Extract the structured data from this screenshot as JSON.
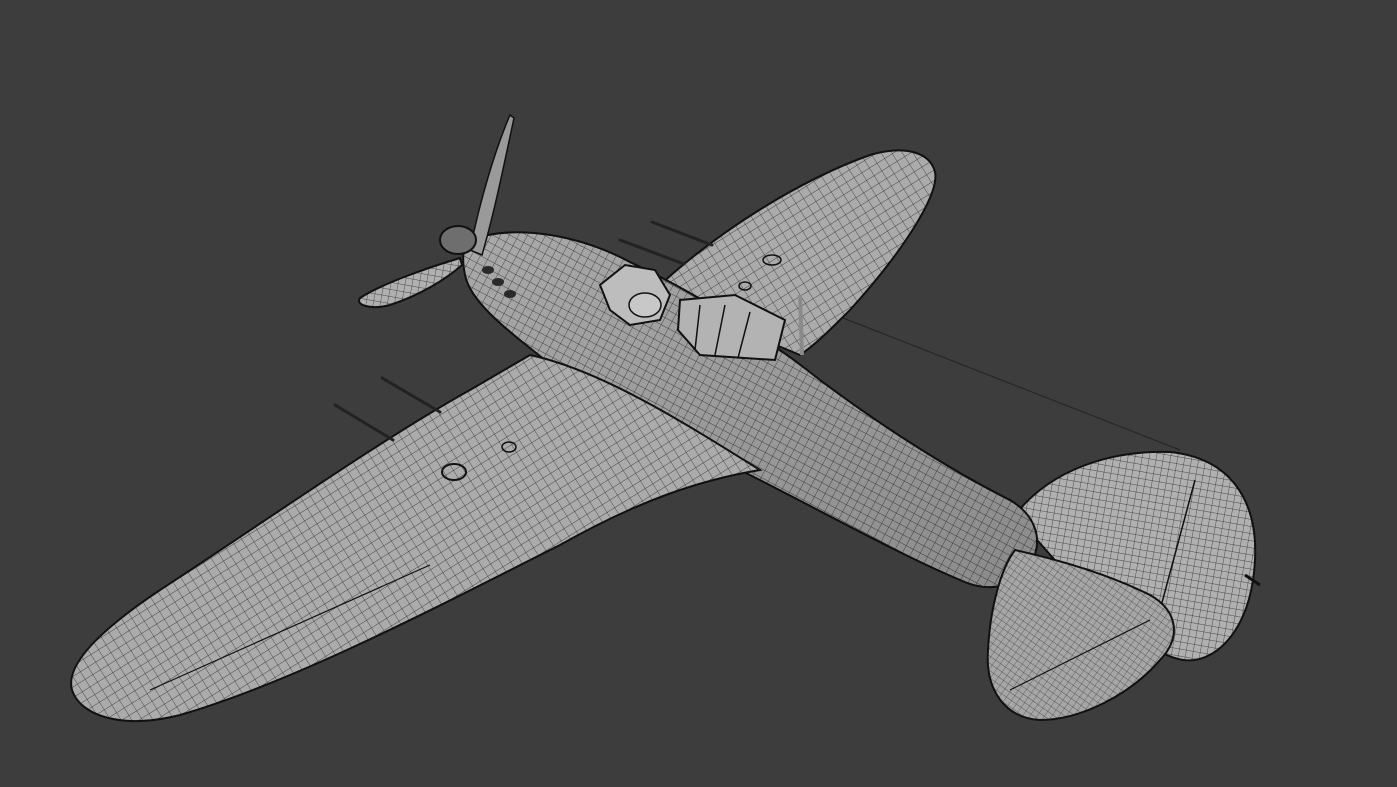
{
  "viewport": {
    "background_color": "#3d3d3d",
    "shading_mode": "wireframe-on-shaded",
    "object": "aircraft-model",
    "surface_color": "#a8a8a8",
    "wire_color": "#1e1e1e"
  }
}
